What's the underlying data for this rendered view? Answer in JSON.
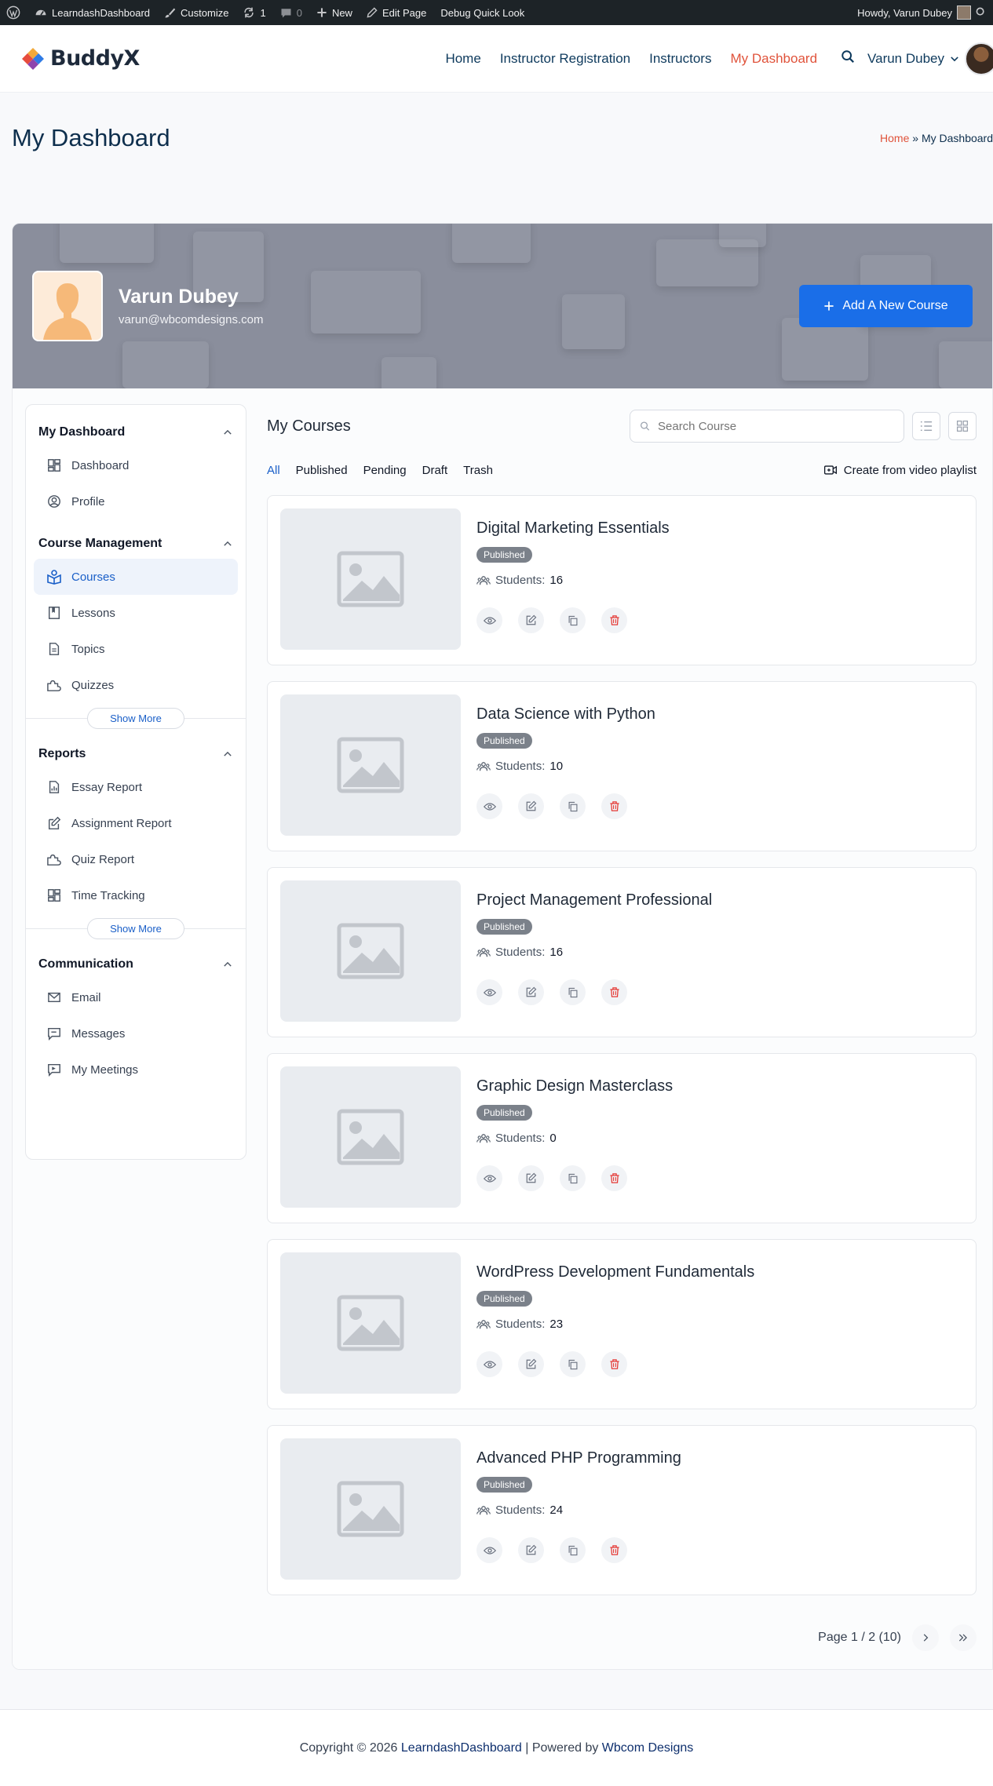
{
  "adminbar": {
    "site": "LearndashDashboard",
    "customize": "Customize",
    "updates": "1",
    "comments": "0",
    "new": "New",
    "edit_page": "Edit Page",
    "debug": "Debug Quick Look",
    "howdy": "Howdy, Varun Dubey"
  },
  "header": {
    "logo": "BuddyX",
    "nav": [
      "Home",
      "Instructor Registration",
      "Instructors",
      "My Dashboard"
    ],
    "user": "Varun Dubey"
  },
  "titleband": {
    "title": "My Dashboard",
    "breadcrumb_home": "Home",
    "breadcrumb_sep": "»",
    "breadcrumb_current": "My Dashboard"
  },
  "profile": {
    "name": "Varun Dubey",
    "email": "varun@wbcomdesigns.com",
    "add_button": "Add A New Course"
  },
  "sidebar": {
    "sections": [
      {
        "title": "My Dashboard",
        "items": [
          {
            "label": "Dashboard",
            "icon": "dashboard-icon"
          },
          {
            "label": "Profile",
            "icon": "user-circle-icon"
          }
        ]
      },
      {
        "title": "Course Management",
        "items": [
          {
            "label": "Courses",
            "icon": "courses-icon"
          },
          {
            "label": "Lessons",
            "icon": "book-icon"
          },
          {
            "label": "Topics",
            "icon": "document-icon"
          },
          {
            "label": "Quizzes",
            "icon": "puzzle-icon"
          }
        ],
        "show_more": "Show More"
      },
      {
        "title": "Reports",
        "items": [
          {
            "label": "Essay Report",
            "icon": "chart-doc-icon"
          },
          {
            "label": "Assignment Report",
            "icon": "assignment-icon"
          },
          {
            "label": "Quiz Report",
            "icon": "puzzle-icon"
          },
          {
            "label": "Time Tracking",
            "icon": "dashboard-icon"
          }
        ],
        "show_more": "Show More"
      },
      {
        "title": "Communication",
        "items": [
          {
            "label": "Email",
            "icon": "mail-icon"
          },
          {
            "label": "Messages",
            "icon": "message-icon"
          },
          {
            "label": "My Meetings",
            "icon": "meeting-icon"
          }
        ]
      }
    ]
  },
  "main": {
    "title": "My Courses",
    "search_placeholder": "Search Course",
    "tabs": [
      "All",
      "Published",
      "Pending",
      "Draft",
      "Trash"
    ],
    "playlist": "Create from video playlist",
    "students_label": "Students:",
    "courses": [
      {
        "title": "Digital Marketing Essentials",
        "status": "Published",
        "students": "16"
      },
      {
        "title": "Data Science with Python",
        "status": "Published",
        "students": "10"
      },
      {
        "title": "Project Management Professional",
        "status": "Published",
        "students": "16"
      },
      {
        "title": "Graphic Design Masterclass",
        "status": "Published",
        "students": "0"
      },
      {
        "title": "WordPress Development Fundamentals",
        "status": "Published",
        "students": "23"
      },
      {
        "title": "Advanced PHP Programming",
        "status": "Published",
        "students": "24"
      }
    ],
    "pagination": "Page 1 / 2 (10)"
  },
  "footer": {
    "prefix": "Copyright © 2026",
    "site": "LearndashDashboard",
    "middle": "| Powered by",
    "company": "Wbcom Designs"
  },
  "colors": {
    "accent": "#1a6ee8",
    "active_nav": "#e0533b",
    "badge": "#7b818a",
    "delete": "#e53935"
  }
}
